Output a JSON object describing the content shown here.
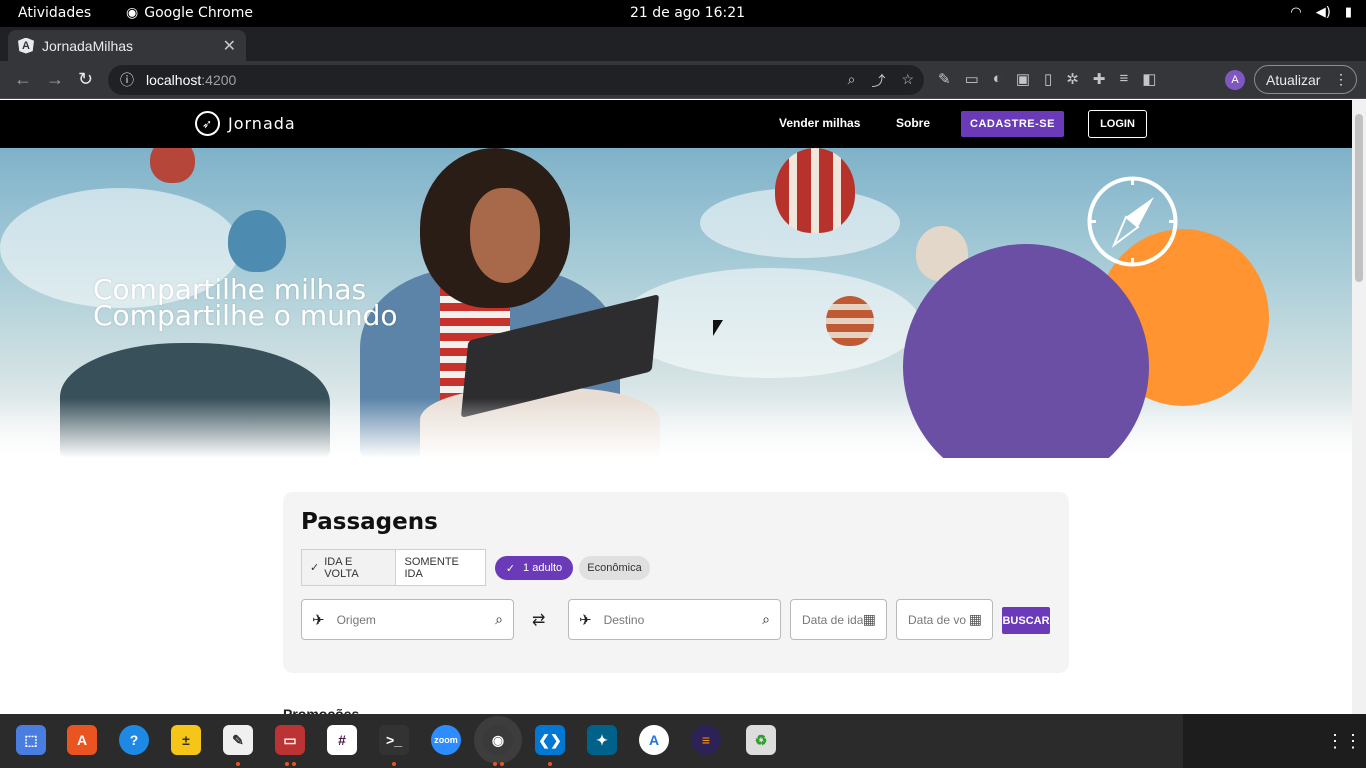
{
  "os": {
    "activities": "Atividades",
    "app_name": "Google Chrome",
    "clock": "21 de ago  16:21"
  },
  "browser": {
    "tab_title": "JornadaMilhas",
    "url_host": "localhost",
    "url_port": ":4200",
    "update_label": "Atualizar",
    "avatar_letter": "A"
  },
  "site": {
    "logo_text": "Jornada",
    "nav": {
      "sell_miles": "Vender milhas",
      "about": "Sobre",
      "signup": "CADASTRE-SE",
      "login": "LOGIN"
    },
    "hero": {
      "line1": "Compartilhe milhas",
      "line2": "Compartilhe o mundo"
    },
    "search": {
      "title": "Passagens",
      "trip_round": "IDA E VOLTA",
      "trip_oneway": "SOMENTE IDA",
      "passengers": "1 adulto",
      "cabin": "Econômica",
      "origin_placeholder": "Origem",
      "destination_placeholder": "Destino",
      "depart_placeholder": "Data de ida",
      "return_placeholder": "Data de vo",
      "search_button": "BUSCAR"
    },
    "promo_heading": "Promoções"
  },
  "colors": {
    "brand_purple": "#6a3ab8",
    "hero_purple": "#6a4fa5",
    "hero_orange": "#ff9431"
  }
}
